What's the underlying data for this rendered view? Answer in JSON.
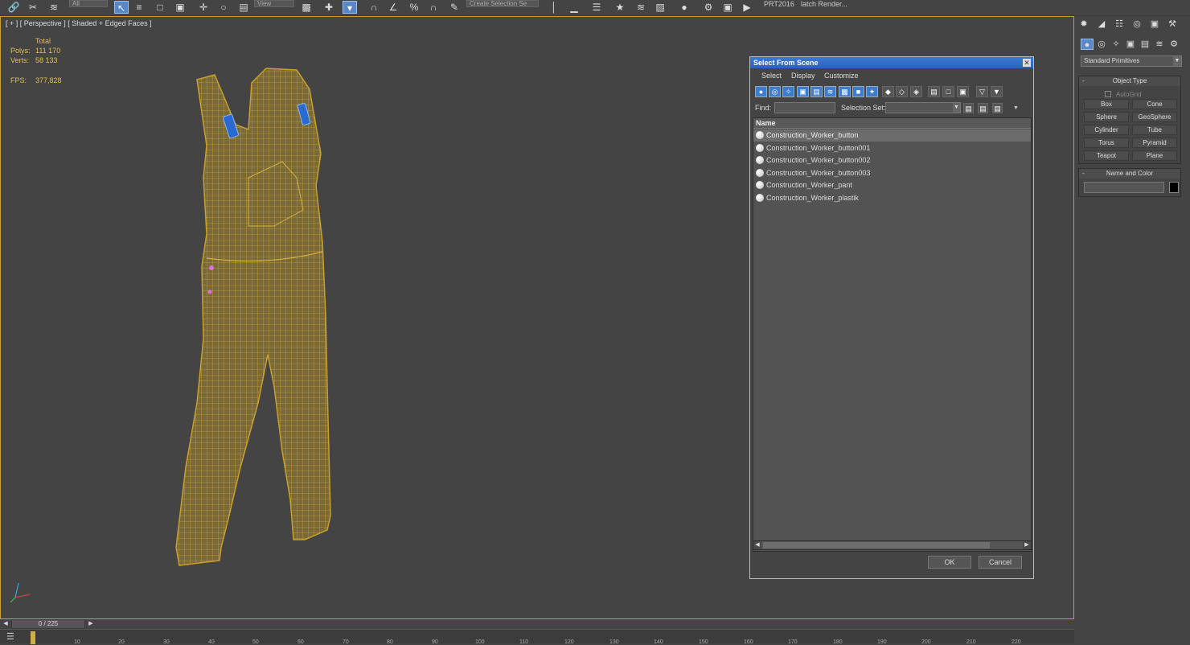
{
  "toolbar": {
    "combo_all": "All",
    "combo_view": "View",
    "combo_selection_set": "Create Selection Se",
    "prt_label": "PRT2016",
    "batch_render_label": "latch Render..."
  },
  "viewport": {
    "label": "[ + ] [ Perspective ] [ Shaded + Edged Faces ]",
    "stats": {
      "total_label": "Total",
      "polys_label": "Polys:",
      "polys_value": "111 170",
      "verts_label": "Verts:",
      "verts_value": "58 133",
      "fps_label": "FPS:",
      "fps_value": "377,828"
    }
  },
  "dialog": {
    "title": "Select From Scene",
    "menu": [
      "Select",
      "Display",
      "Customize"
    ],
    "find_label": "Find:",
    "find_value": "",
    "selection_set_label": "Selection Set:",
    "selection_set_value": "",
    "column_name": "Name",
    "items": [
      "Construction_Worker_button",
      "Construction_Worker_button001",
      "Construction_Worker_button002",
      "Construction_Worker_button003",
      "Construction_Worker_pant",
      "Construction_Worker_plastik"
    ],
    "ok_label": "OK",
    "cancel_label": "Cancel"
  },
  "command_panel": {
    "category": "Standard Primitives",
    "object_type_title": "Object Type",
    "autogrid_label": "AutoGrid",
    "primitives": [
      "Box",
      "Cone",
      "Sphere",
      "GeoSphere",
      "Cylinder",
      "Tube",
      "Torus",
      "Pyramid",
      "Teapot",
      "Plane"
    ],
    "name_color_title": "Name and Color",
    "name_value": ""
  },
  "timeline": {
    "frame_label": "0 / 225",
    "ticks": [
      "10",
      "20",
      "30",
      "40",
      "50",
      "60",
      "70",
      "80",
      "90",
      "100",
      "110",
      "120",
      "130",
      "140",
      "150",
      "160",
      "170",
      "180",
      "190",
      "200",
      "210",
      "220"
    ]
  },
  "colors": {
    "wire": "#c9a02c",
    "strap_blue": "#2a6ad0",
    "selection_blue": "#3a7ad6",
    "stats_yellow": "#e0c050"
  }
}
